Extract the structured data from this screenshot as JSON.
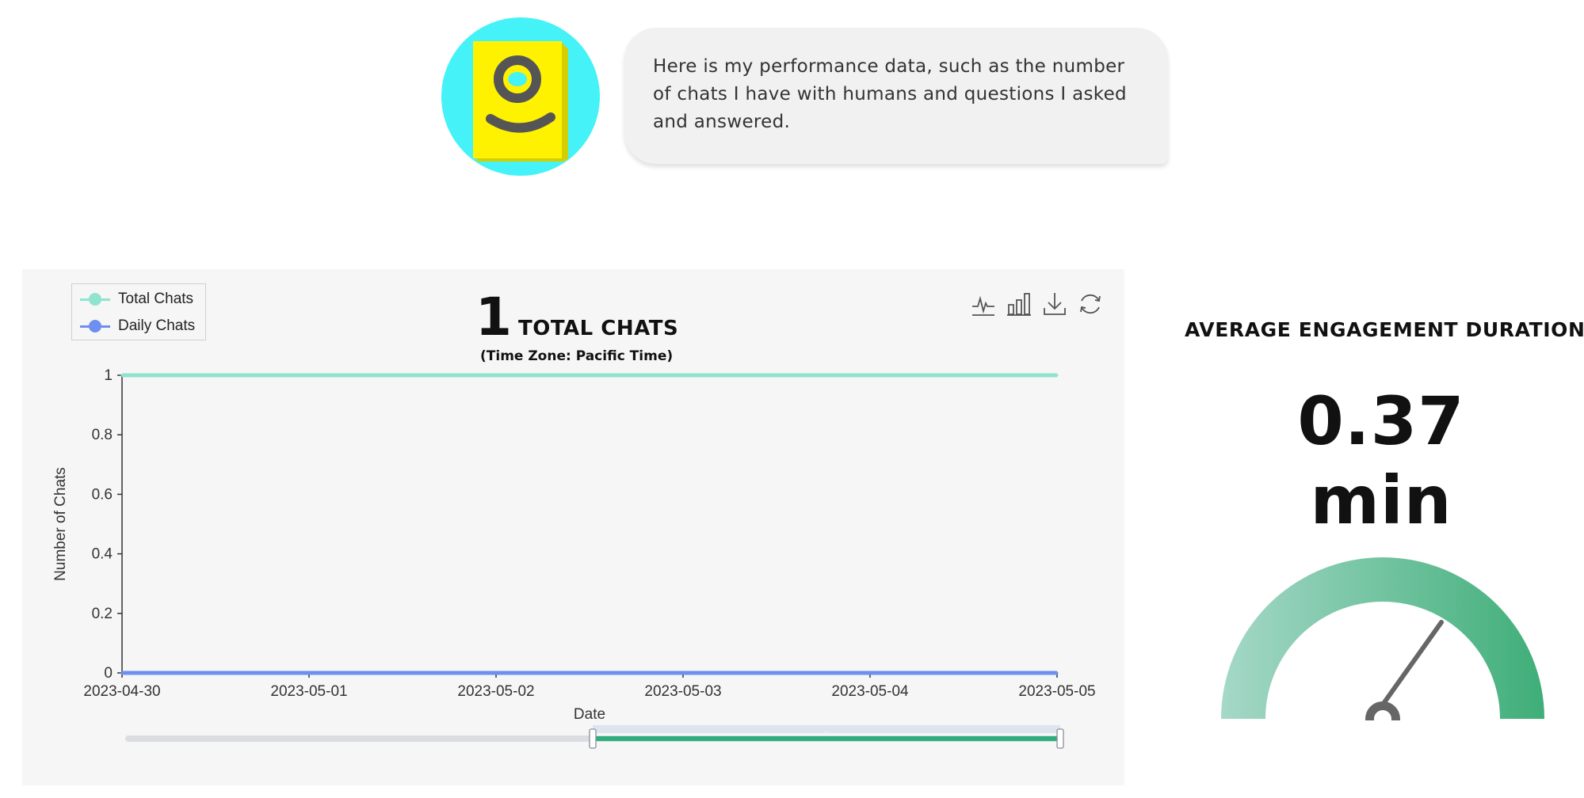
{
  "bot": {
    "avatar_icon": "bot-avatar-icon",
    "message": "Here is my performance data, such as the number of chats I have with humans and questions I asked and answered."
  },
  "chart_panel": {
    "total_count": "1",
    "total_label": "TOTAL CHATS",
    "timezone_note": "(Time Zone: Pacific Time)",
    "toolbox": [
      "line-chart-icon",
      "bar-chart-icon",
      "download-icon",
      "refresh-icon"
    ]
  },
  "chart_data": {
    "type": "line",
    "x": [
      "2023-04-30",
      "2023-05-01",
      "2023-05-02",
      "2023-05-03",
      "2023-05-04",
      "2023-05-05"
    ],
    "xlabel": "Date",
    "ylabel": "Number of Chats",
    "ylim": [
      0,
      1
    ],
    "yticks": [
      "0",
      "0.2",
      "0.4",
      "0.6",
      "0.8",
      "1"
    ],
    "legend_position": "top-left",
    "series": [
      {
        "name": "Total Chats",
        "color": "#8fe3cf",
        "values": [
          1,
          1,
          1,
          1,
          1,
          1
        ]
      },
      {
        "name": "Daily Chats",
        "color": "#6f8ff0",
        "values": [
          0,
          0,
          0,
          0,
          0,
          0
        ]
      }
    ],
    "zoom_slider": {
      "start_fraction": 0.5,
      "end_fraction": 1.0,
      "handle_label": "..."
    }
  },
  "engagement": {
    "title": "AVERAGE ENGAGEMENT DURATION",
    "value": "0.37 min",
    "gauge_colors": [
      "#a5d8c8",
      "#3fae78"
    ]
  }
}
